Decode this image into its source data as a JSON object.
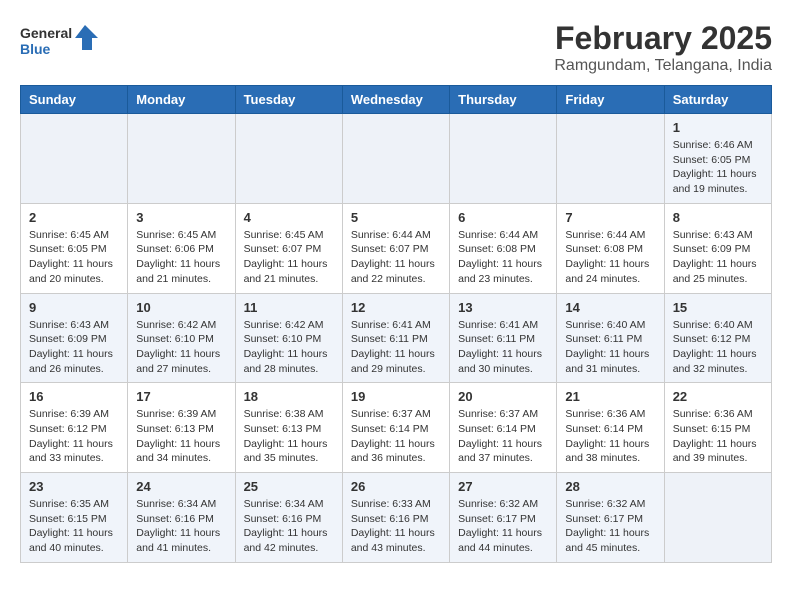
{
  "header": {
    "logo_general": "General",
    "logo_blue": "Blue",
    "month_title": "February 2025",
    "location": "Ramgundam, Telangana, India"
  },
  "weekdays": [
    "Sunday",
    "Monday",
    "Tuesday",
    "Wednesday",
    "Thursday",
    "Friday",
    "Saturday"
  ],
  "weeks": [
    [
      {
        "day": "",
        "info": ""
      },
      {
        "day": "",
        "info": ""
      },
      {
        "day": "",
        "info": ""
      },
      {
        "day": "",
        "info": ""
      },
      {
        "day": "",
        "info": ""
      },
      {
        "day": "",
        "info": ""
      },
      {
        "day": "1",
        "info": "Sunrise: 6:46 AM\nSunset: 6:05 PM\nDaylight: 11 hours\nand 19 minutes."
      }
    ],
    [
      {
        "day": "2",
        "info": "Sunrise: 6:45 AM\nSunset: 6:05 PM\nDaylight: 11 hours\nand 20 minutes."
      },
      {
        "day": "3",
        "info": "Sunrise: 6:45 AM\nSunset: 6:06 PM\nDaylight: 11 hours\nand 21 minutes."
      },
      {
        "day": "4",
        "info": "Sunrise: 6:45 AM\nSunset: 6:07 PM\nDaylight: 11 hours\nand 21 minutes."
      },
      {
        "day": "5",
        "info": "Sunrise: 6:44 AM\nSunset: 6:07 PM\nDaylight: 11 hours\nand 22 minutes."
      },
      {
        "day": "6",
        "info": "Sunrise: 6:44 AM\nSunset: 6:08 PM\nDaylight: 11 hours\nand 23 minutes."
      },
      {
        "day": "7",
        "info": "Sunrise: 6:44 AM\nSunset: 6:08 PM\nDaylight: 11 hours\nand 24 minutes."
      },
      {
        "day": "8",
        "info": "Sunrise: 6:43 AM\nSunset: 6:09 PM\nDaylight: 11 hours\nand 25 minutes."
      }
    ],
    [
      {
        "day": "9",
        "info": "Sunrise: 6:43 AM\nSunset: 6:09 PM\nDaylight: 11 hours\nand 26 minutes."
      },
      {
        "day": "10",
        "info": "Sunrise: 6:42 AM\nSunset: 6:10 PM\nDaylight: 11 hours\nand 27 minutes."
      },
      {
        "day": "11",
        "info": "Sunrise: 6:42 AM\nSunset: 6:10 PM\nDaylight: 11 hours\nand 28 minutes."
      },
      {
        "day": "12",
        "info": "Sunrise: 6:41 AM\nSunset: 6:11 PM\nDaylight: 11 hours\nand 29 minutes."
      },
      {
        "day": "13",
        "info": "Sunrise: 6:41 AM\nSunset: 6:11 PM\nDaylight: 11 hours\nand 30 minutes."
      },
      {
        "day": "14",
        "info": "Sunrise: 6:40 AM\nSunset: 6:11 PM\nDaylight: 11 hours\nand 31 minutes."
      },
      {
        "day": "15",
        "info": "Sunrise: 6:40 AM\nSunset: 6:12 PM\nDaylight: 11 hours\nand 32 minutes."
      }
    ],
    [
      {
        "day": "16",
        "info": "Sunrise: 6:39 AM\nSunset: 6:12 PM\nDaylight: 11 hours\nand 33 minutes."
      },
      {
        "day": "17",
        "info": "Sunrise: 6:39 AM\nSunset: 6:13 PM\nDaylight: 11 hours\nand 34 minutes."
      },
      {
        "day": "18",
        "info": "Sunrise: 6:38 AM\nSunset: 6:13 PM\nDaylight: 11 hours\nand 35 minutes."
      },
      {
        "day": "19",
        "info": "Sunrise: 6:37 AM\nSunset: 6:14 PM\nDaylight: 11 hours\nand 36 minutes."
      },
      {
        "day": "20",
        "info": "Sunrise: 6:37 AM\nSunset: 6:14 PM\nDaylight: 11 hours\nand 37 minutes."
      },
      {
        "day": "21",
        "info": "Sunrise: 6:36 AM\nSunset: 6:14 PM\nDaylight: 11 hours\nand 38 minutes."
      },
      {
        "day": "22",
        "info": "Sunrise: 6:36 AM\nSunset: 6:15 PM\nDaylight: 11 hours\nand 39 minutes."
      }
    ],
    [
      {
        "day": "23",
        "info": "Sunrise: 6:35 AM\nSunset: 6:15 PM\nDaylight: 11 hours\nand 40 minutes."
      },
      {
        "day": "24",
        "info": "Sunrise: 6:34 AM\nSunset: 6:16 PM\nDaylight: 11 hours\nand 41 minutes."
      },
      {
        "day": "25",
        "info": "Sunrise: 6:34 AM\nSunset: 6:16 PM\nDaylight: 11 hours\nand 42 minutes."
      },
      {
        "day": "26",
        "info": "Sunrise: 6:33 AM\nSunset: 6:16 PM\nDaylight: 11 hours\nand 43 minutes."
      },
      {
        "day": "27",
        "info": "Sunrise: 6:32 AM\nSunset: 6:17 PM\nDaylight: 11 hours\nand 44 minutes."
      },
      {
        "day": "28",
        "info": "Sunrise: 6:32 AM\nSunset: 6:17 PM\nDaylight: 11 hours\nand 45 minutes."
      },
      {
        "day": "",
        "info": ""
      }
    ]
  ]
}
